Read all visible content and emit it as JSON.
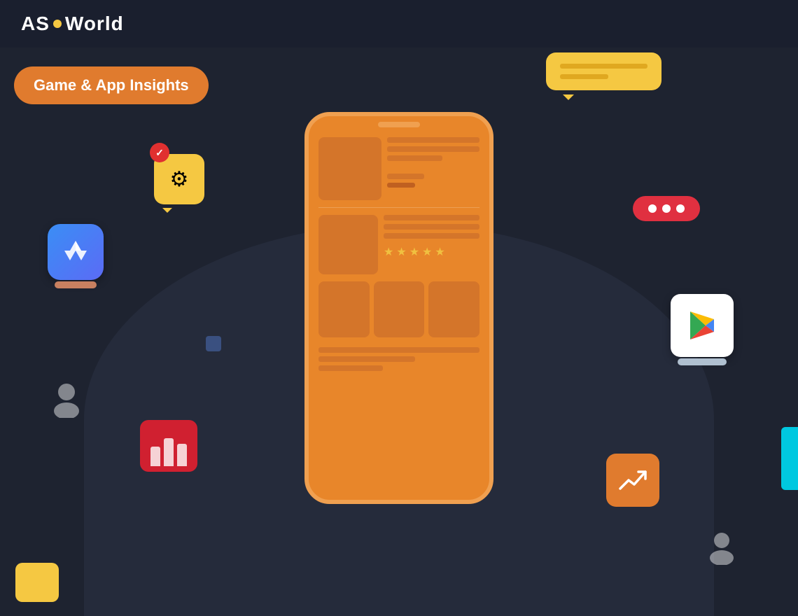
{
  "header": {
    "logo_text_1": "AS",
    "logo_text_2": "World",
    "logo_dot": "•"
  },
  "badge": {
    "label": "Game & App Insights"
  },
  "chat_bubble": {
    "aria": "chat-bubble"
  },
  "gear_bubble": {
    "icon": "⚙"
  },
  "analytics_bars": {
    "aria": "analytics-bar-chart"
  },
  "trend": {
    "icon": "↗"
  },
  "dots_pill": {
    "aria": "more-options"
  },
  "appstore": {
    "aria": "apple-app-store"
  },
  "gplay": {
    "aria": "google-play-store"
  }
}
